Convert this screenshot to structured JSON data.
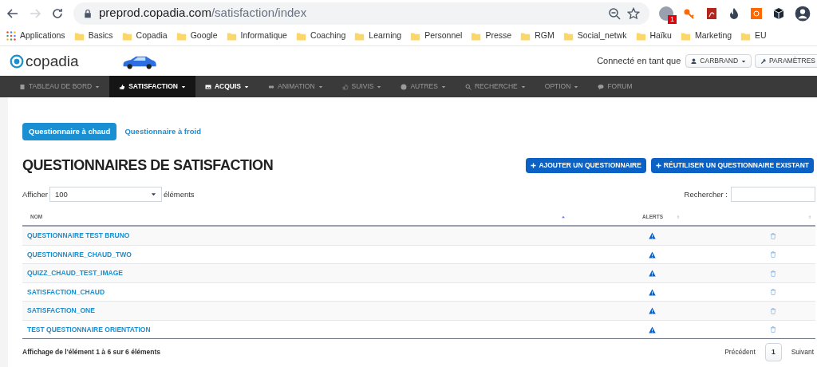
{
  "browser": {
    "url_host": "preprod.copadia.com",
    "url_path": "/satisfaction/index",
    "extension_badge": "1",
    "bookmarks": [
      {
        "label": "Applications",
        "kind": "apps"
      },
      {
        "label": "Basics",
        "kind": "folder"
      },
      {
        "label": "Copadia",
        "kind": "folder"
      },
      {
        "label": "Google",
        "kind": "folder"
      },
      {
        "label": "Informatique",
        "kind": "folder"
      },
      {
        "label": "Coaching",
        "kind": "folder"
      },
      {
        "label": "Learning",
        "kind": "folder"
      },
      {
        "label": "Personnel",
        "kind": "folder"
      },
      {
        "label": "Presse",
        "kind": "folder"
      },
      {
        "label": "RGM",
        "kind": "folder"
      },
      {
        "label": "Social_netwk",
        "kind": "folder"
      },
      {
        "label": "Haïku",
        "kind": "folder"
      },
      {
        "label": "Marketing",
        "kind": "folder"
      },
      {
        "label": "EU",
        "kind": "folder"
      }
    ]
  },
  "header": {
    "logo": "copadia",
    "connected_label": "Connecté en tant que",
    "user_button": "CARBRAND",
    "settings_button": "PARAMÈTRES"
  },
  "nav": [
    {
      "label": "TABLEAU DE BORD",
      "selected": false,
      "emphasized": false,
      "dropdown": true
    },
    {
      "label": "SATISFACTION",
      "selected": true,
      "emphasized": true,
      "dropdown": true
    },
    {
      "label": "ACQUIS",
      "selected": false,
      "emphasized": true,
      "dropdown": true
    },
    {
      "label": "ANIMATION",
      "selected": false,
      "emphasized": false,
      "dropdown": true
    },
    {
      "label": "SUIVIS",
      "selected": false,
      "emphasized": false,
      "dropdown": true
    },
    {
      "label": "AUTRES",
      "selected": false,
      "emphasized": false,
      "dropdown": true
    },
    {
      "label": "RECHERCHE",
      "selected": false,
      "emphasized": false,
      "dropdown": true
    },
    {
      "label": "OPTION",
      "selected": false,
      "emphasized": false,
      "dropdown": true
    },
    {
      "label": "FORUM",
      "selected": false,
      "emphasized": false,
      "dropdown": false
    }
  ],
  "tabs": [
    {
      "label": "Questionnaire à chaud",
      "selected": true
    },
    {
      "label": "Questionnaire à froid",
      "selected": false
    }
  ],
  "title": "QUESTIONNAIRES DE SATISFACTION",
  "actions": [
    "AJOUTER UN QUESTIONNAIRE",
    "RÉUTILISER UN QUESTIONNAIRE EXISTANT"
  ],
  "length_control": {
    "before": "Afficher",
    "value": "100",
    "after": "éléments"
  },
  "search": {
    "label": "Rechercher :"
  },
  "table": {
    "columns": [
      "NOM",
      "ALERTS"
    ],
    "rows": [
      {
        "name": "QUESTIONNAIRE TEST BRUNO"
      },
      {
        "name": "QUESTIONNAIRE_CHAUD_TWO"
      },
      {
        "name": "QUIZZ_CHAUD_TEST_IMAGE"
      },
      {
        "name": "SATISFACTION_CHAUD"
      },
      {
        "name": "SATISFACTION_ONE"
      },
      {
        "name": "TEST QUESTIONNAIRE ORIENTATION"
      }
    ]
  },
  "footer": {
    "info": "Affichage de l'élément 1 à 6 sur 6 éléments",
    "previous": "Précédent",
    "page": "1",
    "next": "Suivant"
  }
}
